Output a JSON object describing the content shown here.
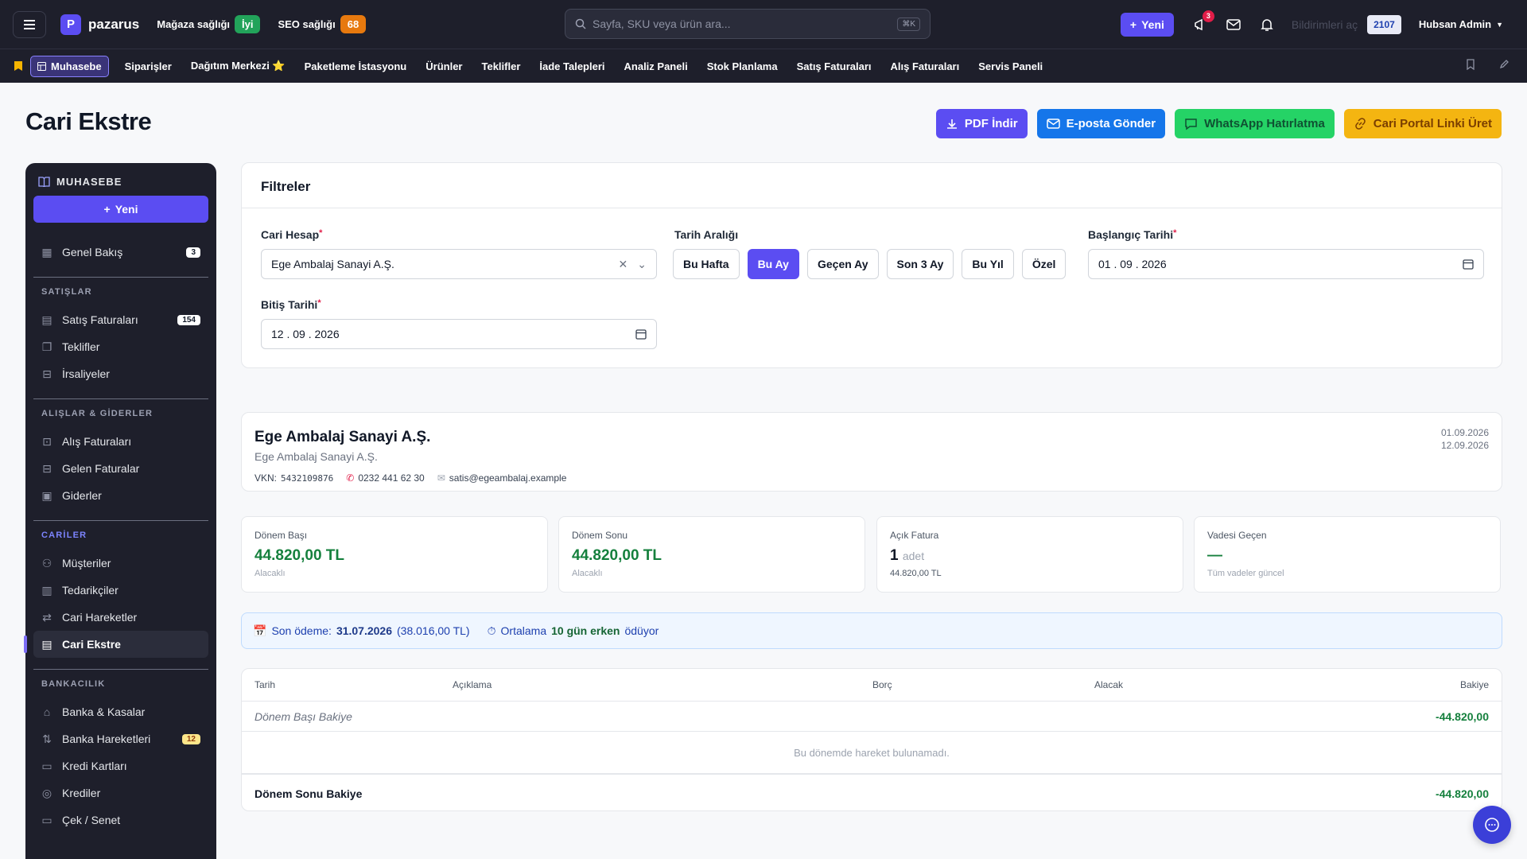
{
  "topbar": {
    "brand": "pazarus",
    "logo_letter": "P",
    "store_health_label": "Mağaza sağlığı",
    "store_health_value": "İyi",
    "seo_health_label": "SEO sağlığı",
    "seo_health_value": "68",
    "search_placeholder": "Sayfa, SKU veya ürün ara...",
    "search_shortcut": "⌘K",
    "new_label": "Yeni",
    "announce_count": "3",
    "notifications_text": "Bildirimleri aç",
    "counter": "2107",
    "user_name": "Hubsan Admin"
  },
  "nav": {
    "active": "Muhasebe",
    "items": [
      "Siparişler",
      "Dağıtım Merkezi ⭐",
      "Paketleme İstasyonu",
      "Ürünler",
      "Teklifler",
      "İade Talepleri",
      "Analiz Paneli",
      "Stok Planlama",
      "Satış Faturaları",
      "Alış Faturaları",
      "Servis Paneli"
    ]
  },
  "page": {
    "title": "Cari Ekstre",
    "actions": {
      "pdf": "PDF İndir",
      "email": "E-posta Gönder",
      "whatsapp": "WhatsApp Hatırlatma",
      "portal": "Cari Portal Linki Üret"
    }
  },
  "sidebar": {
    "title": "MUHASEBE",
    "new_label": "Yeni",
    "overview": {
      "label": "Genel Bakış",
      "count": "3"
    },
    "sections": [
      {
        "title": "SATIŞLAR",
        "items": [
          {
            "label": "Satış Faturaları",
            "count": "154"
          },
          {
            "label": "Teklifler",
            "count": ""
          },
          {
            "label": "İrsaliyeler",
            "count": ""
          }
        ]
      },
      {
        "title": "ALIŞLAR & GİDERLER",
        "items": [
          {
            "label": "Alış Faturaları",
            "count": ""
          },
          {
            "label": "Gelen Faturalar",
            "count": ""
          },
          {
            "label": "Giderler",
            "count": ""
          }
        ]
      },
      {
        "title": "CARİLER",
        "items": [
          {
            "label": "Müşteriler",
            "count": ""
          },
          {
            "label": "Tedarikçiler",
            "count": ""
          },
          {
            "label": "Cari Hareketler",
            "count": ""
          },
          {
            "label": "Cari Ekstre",
            "count": ""
          }
        ]
      },
      {
        "title": "BANKACILIK",
        "items": [
          {
            "label": "Banka & Kasalar",
            "count": ""
          },
          {
            "label": "Banka Hareketleri",
            "count": "12"
          },
          {
            "label": "Kredi Kartları",
            "count": ""
          },
          {
            "label": "Krediler",
            "count": ""
          },
          {
            "label": "Çek / Senet",
            "count": ""
          }
        ]
      }
    ]
  },
  "filters": {
    "title": "Filtreler",
    "account_label": "Cari Hesap",
    "account_value": "Ege Ambalaj Sanayi A.Ş.",
    "range_label": "Tarih Aralığı",
    "range_options": [
      "Bu Hafta",
      "Bu Ay",
      "Geçen Ay",
      "Son 3 Ay",
      "Bu Yıl",
      "Özel"
    ],
    "range_selected": "Bu Ay",
    "start_label": "Başlangıç Tarihi",
    "start_value": "01 . 09 . 2026",
    "end_label": "Bitiş Tarihi",
    "end_value": "12 . 09 . 2026"
  },
  "account": {
    "name": "Ege Ambalaj Sanayi A.Ş.",
    "subtitle": "Ege Ambalaj Sanayi A.Ş.",
    "vkn_label": "VKN:",
    "vkn": "5432109876",
    "phone": "0232 441 62 30",
    "email": "satis@egeambalaj.example",
    "date_from": "01.09.2026",
    "date_to": "12.09.2026"
  },
  "stats": [
    {
      "title": "Dönem Başı",
      "value": "44.820,00 TL",
      "unit": "",
      "sub": "Alacaklı"
    },
    {
      "title": "Dönem Sonu",
      "value": "44.820,00 TL",
      "unit": "",
      "sub": "Alacaklı"
    },
    {
      "title": "Açık Fatura",
      "value": "1",
      "unit": "adet",
      "sub": "44.820,00 TL"
    },
    {
      "title": "Vadesi Geçen",
      "value": "—",
      "unit": "",
      "sub": "Tüm vadeler güncel"
    }
  ],
  "info": {
    "last_payment_label": "Son ödeme:",
    "last_payment_date": "31.07.2026",
    "last_payment_amount": "(38.016,00 TL)",
    "avg_label": "Ortalama",
    "avg_value": "10 gün erken",
    "avg_suffix": "ödüyor"
  },
  "table": {
    "headers": [
      "Tarih",
      "Açıklama",
      "Borç",
      "Alacak",
      "Bakiye"
    ],
    "start_label": "Dönem Başı Bakiye",
    "start_balance": "-44.820,00",
    "empty_text": "Bu dönemde hareket bulunamadı.",
    "end_label": "Dönem Sonu Bakiye",
    "end_balance": "-44.820,00"
  },
  "colors": {
    "accent": "#5b4df2",
    "dark": "#1e1f2b",
    "positive": "#15803d"
  }
}
